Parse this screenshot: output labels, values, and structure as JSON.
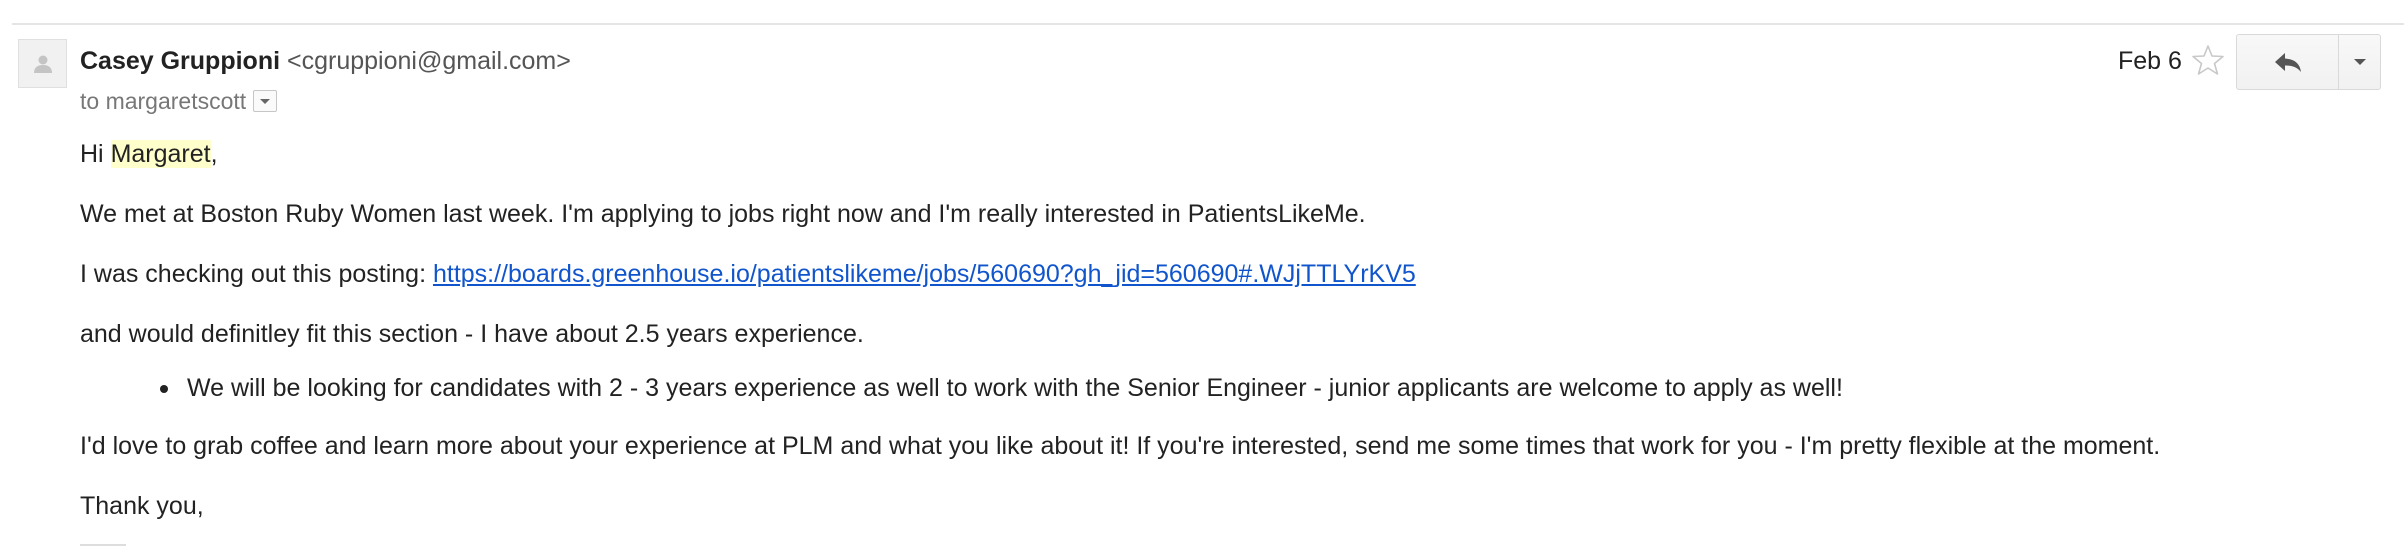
{
  "message": {
    "sender_name": "Casey Gruppioni",
    "sender_email": "<cgruppioni@gmail.com>",
    "to_label": "to margaretscott",
    "date": "Feb 6"
  },
  "actions": {
    "reply_icon": "reply-arrow-icon",
    "more_icon": "chevron-down-icon",
    "star_icon": "star-outline-icon",
    "avatar_icon": "person-silhouette-icon"
  },
  "body": {
    "greeting_prefix": "Hi ",
    "greeting_name": "Margaret",
    "greeting_suffix": ",",
    "paragraph_1": "We met at Boston Ruby Women last week. I'm applying to jobs right now and I'm really interested in PatientsLikeMe.",
    "paragraph_2_prefix": "I was checking out this posting: ",
    "paragraph_2_link": "https://boards.greenhouse.io/patientslikeme/jobs/560690?gh_jid=560690#.WJjTTLYrKV5",
    "paragraph_3": "and would definitley fit this section - I have about 2.5 years experience.",
    "bullet_1": "We will be looking for candidates with 2 - 3 years experience as well to work with the Senior Engineer - junior applicants are welcome to apply as well!",
    "paragraph_4": "I'd love to grab coffee and learn more about your experience at PLM and what you like about it! If you're interested, send me some times that work for you - I'm pretty flexible at the moment.",
    "closing": "Thank you,"
  },
  "colors": {
    "link": "#1155cc",
    "highlight": "#ffffcc",
    "text": "#222222",
    "muted": "#777777"
  }
}
